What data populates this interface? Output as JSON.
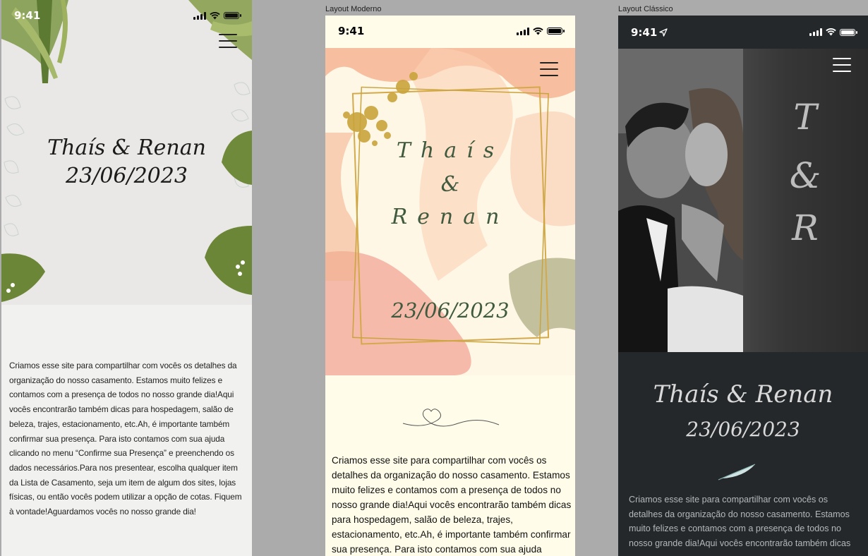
{
  "frames": {
    "modern_label": "Layout Moderno",
    "classic_label": "Layout Clássico"
  },
  "status": {
    "time": "9:41"
  },
  "couple": {
    "names": "Thaís & Renan",
    "name1": "Thaís",
    "amp": "&",
    "name2": "Renan",
    "date": "23/06/2023",
    "initial1": "T",
    "initial2": "R"
  },
  "intro_text": "Criamos esse site para compartilhar com vocês os detalhes da organização do nosso casamento. Estamos muito felizes e contamos com a presença de todos no nosso grande dia!Aqui vocês encontrarão também dicas para hospedagem, salão de beleza, trajes, estacionamento, etc.Ah, é importante também confirmar sua presença. Para isto contamos com sua ajuda clicando no menu “Confirme sua Presença” e preenchendo os dados necessários.Para nos presentear, escolha qualquer item da Lista de Casamento, seja um item de algum dos sites, lojas físicas, ou então vocês podem utilizar a opção de cotas. Fiquem à vontade!Aguardamos vocês no nosso grande dia!",
  "intro_text_modern_visible": "Criamos esse site para compartilhar com vocês os detalhes da organização do nosso casamento. Estamos muito felizes e contamos com a presença de todos no nosso grande dia!Aqui vocês encontrarão também dicas para hospedagem, salão de beleza, trajes, estacionamento, etc.Ah, é importante também confirmar sua presença. Para isto contamos com sua ajuda",
  "intro_text_classic_visible": "Criamos esse site para compartilhar com vocês os detalhes da organização do nosso casamento. Estamos muito felizes e contamos com a presença de todos no nosso grande dia!Aqui vocês encontrarão também dicas",
  "icons": {
    "menu": "hamburger-menu-icon",
    "signal": "signal-icon",
    "wifi": "wifi-icon",
    "battery": "battery-icon",
    "location": "location-arrow-icon",
    "heart": "heart-line-icon",
    "feather": "feather-icon"
  },
  "colors": {
    "leaf_green": "#6f8a3a",
    "modern_text_green": "#3f5a3e",
    "gold": "#c9a43c",
    "peach": "#f4b48f",
    "classic_bg": "#24282b"
  }
}
